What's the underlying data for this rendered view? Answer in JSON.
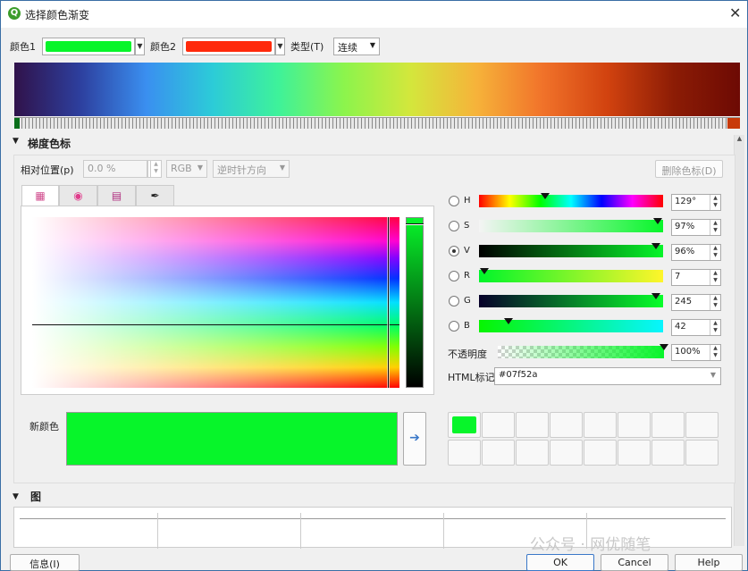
{
  "window": {
    "title": "选择颜色渐变",
    "close_glyph": "✕",
    "app_icon_glyph": "Q"
  },
  "top": {
    "color1_label": "颜色1",
    "color1_underline": "1",
    "color1_value": "#07f52a",
    "color2_label": "颜色2",
    "color2_underline": "2",
    "color2_value": "#ff2a0b",
    "type_label": "类型(T)",
    "type_value": "连续",
    "caret": "▼"
  },
  "stops_section": {
    "title": "梯度色标",
    "collapse_glyph": "▼",
    "relpos_label": "相对位置(p)",
    "relpos_value": "0.0 %",
    "color_model_value": "RGB",
    "direction_value": "逆时针方向",
    "delete_button": "删除色标(D)"
  },
  "picker": {
    "tabs": [
      {
        "name": "color-box-tab",
        "glyph": "▦"
      },
      {
        "name": "color-wheel-tab",
        "glyph": "◉"
      },
      {
        "name": "swatch-grid-tab",
        "glyph": "▤"
      },
      {
        "name": "eyedropper-tab",
        "glyph": "✒"
      }
    ],
    "channels": [
      {
        "key": "H",
        "value": "129°",
        "level": 0.36,
        "checked": false
      },
      {
        "key": "S",
        "value": "97%",
        "level": 0.97,
        "checked": false
      },
      {
        "key": "V",
        "value": "96%",
        "level": 0.96,
        "checked": true
      },
      {
        "key": "R",
        "value": "7",
        "level": 0.03,
        "checked": false
      },
      {
        "key": "G",
        "value": "245",
        "level": 0.96,
        "checked": false
      },
      {
        "key": "B",
        "value": "42",
        "level": 0.16,
        "checked": false
      }
    ],
    "opacity_label": "不透明度",
    "opacity_value": "100%",
    "opacity_level": 1.0,
    "html_label": "HTML标记",
    "html_value": "#07f52a",
    "new_color_label": "新颜色",
    "new_color_value": "#07f52a",
    "arrow_glyph": "➔"
  },
  "plot_section": {
    "title": "图",
    "collapse_glyph": "▼"
  },
  "footer": {
    "info_button": "信息(I)",
    "ok_button": "OK",
    "cancel_button": "Cancel",
    "help_button": "Help"
  },
  "watermark": "公众号 · 网优随笔",
  "colors": {
    "accent": "#07f52a",
    "color2": "#ff2a0b",
    "window_border": "#3a6ea5"
  }
}
